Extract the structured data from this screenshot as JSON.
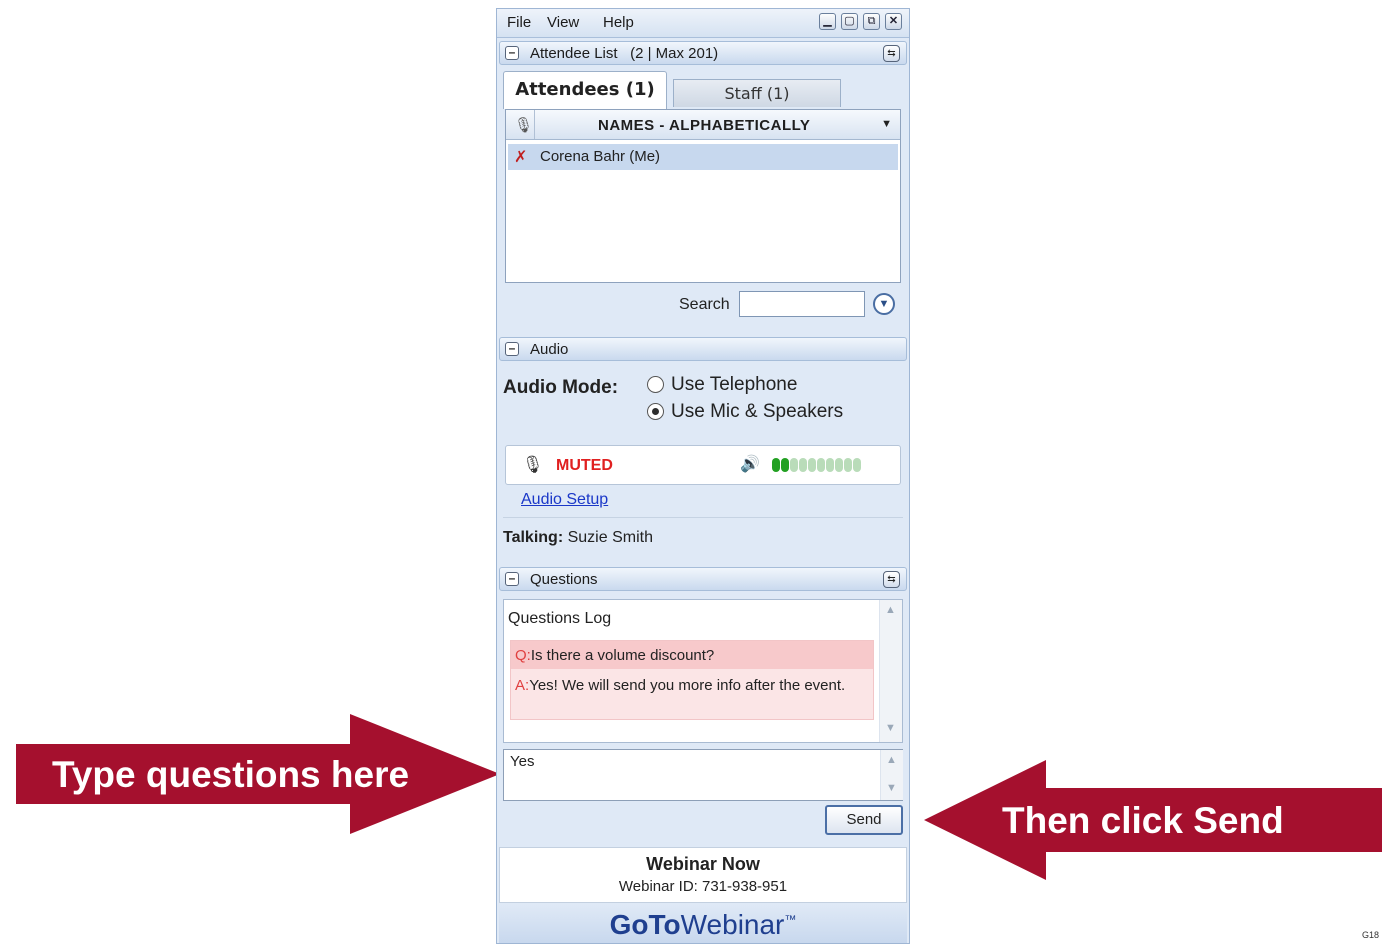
{
  "menubar": {
    "items": [
      "File",
      "View",
      "Help"
    ]
  },
  "attendee_section": {
    "title": "Attendee List",
    "count": "(2 | Max 201)",
    "tabs": [
      "Attendees (1)",
      "Staff (1)"
    ],
    "sort_label": "NAMES - ALPHABETICALLY",
    "attendees": [
      "Corena Bahr (Me)"
    ],
    "search_label": "Search",
    "search_value": ""
  },
  "audio_section": {
    "title": "Audio",
    "mode_label": "Audio Mode:",
    "options": [
      "Use Telephone",
      "Use Mic & Speakers"
    ],
    "selected_option": "Use Mic & Speakers",
    "mic_status": "MUTED",
    "level_active_bars": 2,
    "level_total_bars": 10,
    "setup_link": "Audio Setup",
    "talking_label": "Talking:",
    "talking_name": "Suzie Smith"
  },
  "questions_section": {
    "title": "Questions",
    "log_title": "Questions Log",
    "q_prefix": "Q:",
    "question": "Is there a volume discount?",
    "a_prefix": "A:",
    "answer": "Yes! We will send you more info after the event.",
    "entry_value": "Yes",
    "send_label": "Send"
  },
  "footer": {
    "webinar_title": "Webinar Now",
    "webinar_id": "Webinar ID: 731-938-951",
    "brand_goto": "GoTo",
    "brand_webinar": "Webinar",
    "brand_tm": "™"
  },
  "annotations": {
    "left_arrow_text": "Type questions here",
    "right_arrow_text": "Then click Send",
    "corner_code": "G18"
  },
  "colors": {
    "arrow": "#a5102e",
    "muted": "#e02020",
    "link": "#1a37c8",
    "level_on": "#22a022",
    "level_off": "#b9dcb9"
  }
}
